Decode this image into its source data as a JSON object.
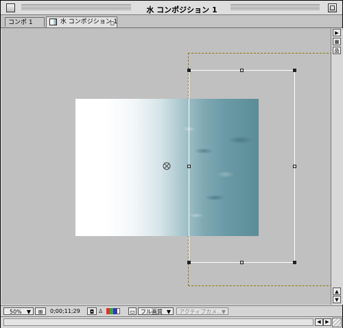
{
  "window": {
    "title": "水 コンポジション 1"
  },
  "tabs": [
    {
      "label": "コンポ 1",
      "active": false
    },
    {
      "label": "水 コンポジション 1",
      "active": true
    }
  ],
  "toolbar": {
    "zoom_label": "50%",
    "timecode": "0;00;11;29",
    "resolution_label": "フル画質",
    "camera_label": "アクティブカメ..."
  },
  "colors": {
    "background": "#c0c0c0",
    "bounds_handles": "#ffffff",
    "safe_frame": "#8a7a00",
    "water_teal": "#5a8d99"
  },
  "icons": {
    "close": "close-box-icon",
    "zoom": "zoom-box-icon",
    "flowchart": "flowchart-icon",
    "snapshot": "camera-icon",
    "show_snapshot": "person-icon",
    "channels": "rgb-channel-icon",
    "region": "region-of-interest-icon",
    "anchor": "anchor-point-icon"
  }
}
